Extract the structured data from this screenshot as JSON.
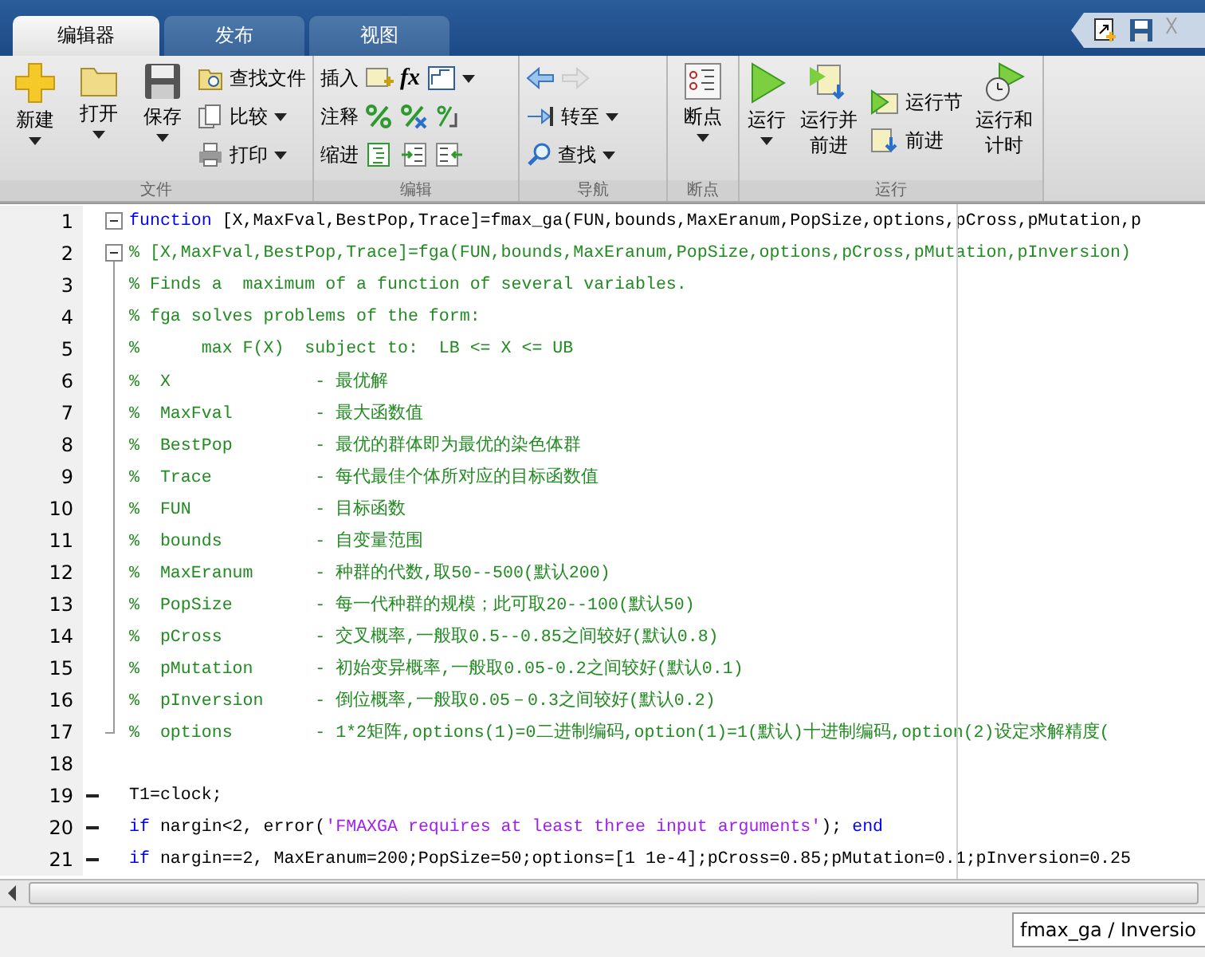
{
  "tabs": [
    {
      "label": "编辑器",
      "selected": true
    },
    {
      "label": "发布",
      "selected": false
    },
    {
      "label": "视图",
      "selected": false
    }
  ],
  "ribbon": {
    "file": {
      "label": "文件",
      "new": {
        "label": "新建",
        "dropdown": true
      },
      "open": {
        "label": "打开",
        "dropdown": true
      },
      "save": {
        "label": "保存",
        "dropdown": true
      },
      "find_files": {
        "label": "查找文件"
      },
      "compare": {
        "label": "比较",
        "dropdown": true
      },
      "print": {
        "label": "打印",
        "dropdown": true
      }
    },
    "edit": {
      "label": "编辑",
      "insert": {
        "label": "插入",
        "dropdown": true,
        "function_icon": "fx"
      },
      "comment": {
        "label": "注释"
      },
      "indent": {
        "label": "缩进"
      }
    },
    "navigate": {
      "label": "导航",
      "back": {
        "disabled": false
      },
      "forward": {
        "disabled": true
      },
      "go_to": {
        "label": "转至",
        "dropdown": true
      },
      "find": {
        "label": "查找",
        "dropdown": true
      }
    },
    "breakpoints": {
      "label": "断点",
      "button": {
        "label": "断点",
        "dropdown": true
      }
    },
    "run": {
      "label": "运行",
      "run": {
        "label": "运行",
        "dropdown": true
      },
      "run_and_advance": {
        "label": "运行并前进"
      },
      "run_section": {
        "label": "运行节"
      },
      "advance": {
        "label": "前进"
      },
      "run_and_time": {
        "label": "运行和计时"
      }
    }
  },
  "editor": {
    "lines": [
      {
        "number": "1",
        "fold_toggle": true,
        "in_fold": false,
        "fold_end": false,
        "executable": false,
        "segments": [
          {
            "kind": "keyword",
            "text": "function"
          },
          {
            "kind": "code",
            "text": " [X,MaxFval,BestPop,Trace]=fmax_ga(FUN,bounds,MaxEranum,PopSize,options,pCross,pMutation,p"
          }
        ]
      },
      {
        "number": "2",
        "fold_toggle": true,
        "in_fold": false,
        "fold_end": false,
        "executable": false,
        "segments": [
          {
            "kind": "comment",
            "text": "% [X,MaxFval,BestPop,Trace]=fga(FUN,bounds,MaxEranum,PopSize,options,pCross,pMutation,pInversion)"
          }
        ]
      },
      {
        "number": "3",
        "fold_toggle": false,
        "in_fold": true,
        "fold_end": false,
        "executable": false,
        "segments": [
          {
            "kind": "comment",
            "text": "% Finds a  maximum of a function of several variables."
          }
        ]
      },
      {
        "number": "4",
        "fold_toggle": false,
        "in_fold": true,
        "fold_end": false,
        "executable": false,
        "segments": [
          {
            "kind": "comment",
            "text": "% fga solves problems of the form:"
          }
        ]
      },
      {
        "number": "5",
        "fold_toggle": false,
        "in_fold": true,
        "fold_end": false,
        "executable": false,
        "segments": [
          {
            "kind": "comment",
            "text": "%      max F(X)  subject to:  LB <= X <= UB"
          }
        ]
      },
      {
        "number": "6",
        "fold_toggle": false,
        "in_fold": true,
        "fold_end": false,
        "executable": false,
        "segments": [
          {
            "kind": "comment",
            "text": "%  X              - 最优解"
          }
        ]
      },
      {
        "number": "7",
        "fold_toggle": false,
        "in_fold": true,
        "fold_end": false,
        "executable": false,
        "segments": [
          {
            "kind": "comment",
            "text": "%  MaxFval        - 最大函数值"
          }
        ]
      },
      {
        "number": "8",
        "fold_toggle": false,
        "in_fold": true,
        "fold_end": false,
        "executable": false,
        "segments": [
          {
            "kind": "comment",
            "text": "%  BestPop        - 最优的群体即为最优的染色体群"
          }
        ]
      },
      {
        "number": "9",
        "fold_toggle": false,
        "in_fold": true,
        "fold_end": false,
        "executable": false,
        "segments": [
          {
            "kind": "comment",
            "text": "%  Trace          - 每代最佳个体所对应的目标函数值"
          }
        ]
      },
      {
        "number": "10",
        "fold_toggle": false,
        "in_fold": true,
        "fold_end": false,
        "executable": false,
        "segments": [
          {
            "kind": "comment",
            "text": "%  FUN            - 目标函数"
          }
        ]
      },
      {
        "number": "11",
        "fold_toggle": false,
        "in_fold": true,
        "fold_end": false,
        "executable": false,
        "segments": [
          {
            "kind": "comment",
            "text": "%  bounds         - 自变量范围"
          }
        ]
      },
      {
        "number": "12",
        "fold_toggle": false,
        "in_fold": true,
        "fold_end": false,
        "executable": false,
        "segments": [
          {
            "kind": "comment",
            "text": "%  MaxEranum      - 种群的代数,取50--500(默认200)"
          }
        ]
      },
      {
        "number": "13",
        "fold_toggle": false,
        "in_fold": true,
        "fold_end": false,
        "executable": false,
        "segments": [
          {
            "kind": "comment",
            "text": "%  PopSize        - 每一代种群的规模；此可取20--100(默认50)"
          }
        ]
      },
      {
        "number": "14",
        "fold_toggle": false,
        "in_fold": true,
        "fold_end": false,
        "executable": false,
        "segments": [
          {
            "kind": "comment",
            "text": "%  pCross         - 交叉概率,一般取0.5--0.85之间较好(默认0.8)"
          }
        ]
      },
      {
        "number": "15",
        "fold_toggle": false,
        "in_fold": true,
        "fold_end": false,
        "executable": false,
        "segments": [
          {
            "kind": "comment",
            "text": "%  pMutation      - 初始变异概率,一般取0.05-0.2之间较好(默认0.1)"
          }
        ]
      },
      {
        "number": "16",
        "fold_toggle": false,
        "in_fold": true,
        "fold_end": false,
        "executable": false,
        "segments": [
          {
            "kind": "comment",
            "text": "%  pInversion     - 倒位概率,一般取0.05－0.3之间较好(默认0.2)"
          }
        ]
      },
      {
        "number": "17",
        "fold_toggle": false,
        "in_fold": false,
        "fold_end": true,
        "executable": false,
        "segments": [
          {
            "kind": "comment",
            "text": "%  options        - 1*2矩阵,options(1)=0二进制编码,option(1)=1(默认)十进制编码,option(2)设定求解精度("
          }
        ]
      },
      {
        "number": "18",
        "fold_toggle": false,
        "in_fold": false,
        "fold_end": false,
        "executable": false
      },
      {
        "number": "19",
        "fold_toggle": false,
        "in_fold": false,
        "fold_end": false,
        "executable": true,
        "segments": [
          {
            "kind": "code",
            "text": "T1=clock;"
          }
        ]
      },
      {
        "number": "20",
        "fold_toggle": false,
        "in_fold": false,
        "fold_end": false,
        "executable": true,
        "segments": [
          {
            "kind": "keyword",
            "text": "if"
          },
          {
            "kind": "code",
            "text": " nargin<2, error("
          },
          {
            "kind": "string",
            "text": "'FMAXGA requires at least three input arguments'"
          },
          {
            "kind": "code",
            "text": "); "
          },
          {
            "kind": "keyword",
            "text": "end"
          }
        ]
      },
      {
        "number": "21",
        "fold_toggle": false,
        "in_fold": false,
        "fold_end": false,
        "executable": true,
        "segments": [
          {
            "kind": "keyword",
            "text": "if"
          },
          {
            "kind": "code",
            "text": " nargin==2, MaxEranum=200;PopSize=50;options=[1 1e-4];pCross=0.85;pMutation=0.1;pInversion=0.25"
          }
        ]
      }
    ]
  },
  "status_bar": {
    "function_path": "fmax_ga / Inversio"
  }
}
